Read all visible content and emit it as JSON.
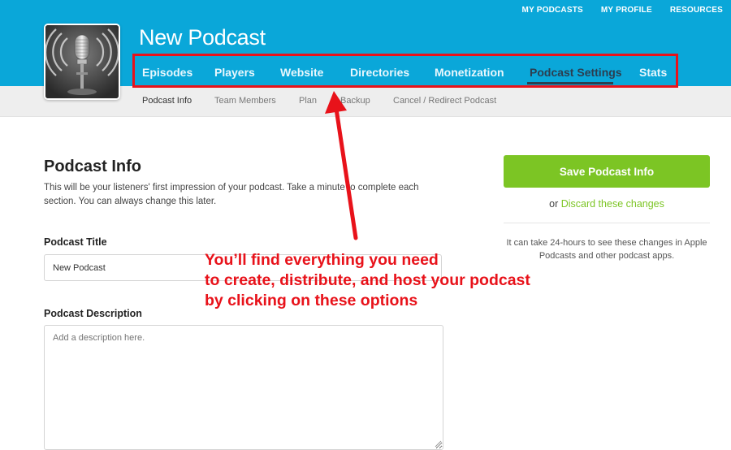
{
  "top_links": [
    "MY PODCASTS",
    "MY PROFILE",
    "RESOURCES"
  ],
  "podcast": {
    "title": "New Podcast"
  },
  "main_nav": [
    {
      "label": "Episodes"
    },
    {
      "label": "Players"
    },
    {
      "label": "Website"
    },
    {
      "label": "Directories"
    },
    {
      "label": "Monetization"
    },
    {
      "label": "Podcast Settings",
      "active": true
    },
    {
      "label": "Stats"
    }
  ],
  "sub_nav": [
    {
      "label": "Podcast Info",
      "active": true
    },
    {
      "label": "Team Members"
    },
    {
      "label": "Plan"
    },
    {
      "label": "Backup"
    },
    {
      "label": "Cancel / Redirect Podcast"
    }
  ],
  "form": {
    "section_title": "Podcast Info",
    "section_desc": "This will be your listeners' first impression of your podcast. Take a minute to complete each section. You can always change this later.",
    "title_label": "Podcast Title",
    "title_value": "New Podcast",
    "desc_label": "Podcast Description",
    "desc_placeholder": "Add a description here."
  },
  "sidebar": {
    "save_label": "Save Podcast Info",
    "discard_prefix": "or ",
    "discard_link": "Discard these changes",
    "note": "It can take 24-hours to see these changes in Apple Podcasts and other podcast apps."
  },
  "annotation": {
    "lines": [
      "You’ll find everything you need",
      "to create, distribute, and host your podcast",
      "by clicking on these options"
    ]
  },
  "colors": {
    "header": "#0aa7d9",
    "accent_green": "#7cc524",
    "annotation_red": "#e8121a",
    "active_tab": "#2c3e50"
  }
}
